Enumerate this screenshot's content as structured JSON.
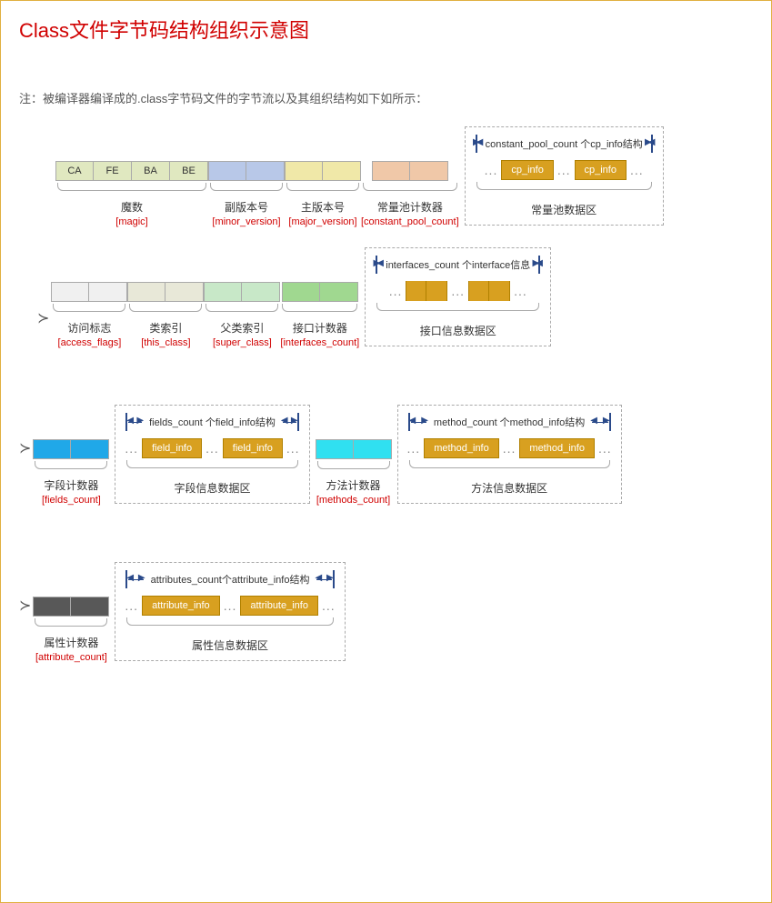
{
  "title": "Class文件字节码结构组织示意图",
  "note": "注：被编译器编译成的.class字节码文件的字节流以及其组织结构如下如所示：",
  "row1": {
    "magic": {
      "bytes": [
        "CA",
        "FE",
        "BA",
        "BE"
      ],
      "cn": "魔数",
      "en": "[magic]"
    },
    "minor": {
      "cn": "副版本号",
      "en": "[minor_version]"
    },
    "major": {
      "cn": "主版本号",
      "en": "[major_version]"
    },
    "cpcount": {
      "cn": "常量池计数器",
      "en": "[constant_pool_count]"
    },
    "cparea": {
      "bar": "constant_pool_count 个cp_info结构",
      "item": "cp_info",
      "label": "常量池数据区"
    }
  },
  "row2": {
    "access": {
      "cn": "访问标志",
      "en": "[access_flags]"
    },
    "this": {
      "cn": "类索引",
      "en": "[this_class]"
    },
    "super": {
      "cn": "父类索引",
      "en": "[super_class]"
    },
    "ifcount": {
      "cn": "接口计数器",
      "en": "[interfaces_count]"
    },
    "ifarea": {
      "bar": "interfaces_count 个interface信息",
      "label": "接口信息数据区"
    }
  },
  "row3": {
    "fcount": {
      "cn": "字段计数器",
      "en": "[fields_count]"
    },
    "farea": {
      "bar": "fields_count 个field_info结构",
      "item": "field_info",
      "label": "字段信息数据区"
    },
    "mcount": {
      "cn": "方法计数器",
      "en": "[methods_count]"
    },
    "marea": {
      "bar": "method_count 个method_info结构",
      "item": "method_info",
      "label": "方法信息数据区"
    }
  },
  "row4": {
    "acount": {
      "cn": "属性计数器",
      "en": "[attribute_count]"
    },
    "aarea": {
      "bar": "attributes_count个attribute_info结构",
      "item": "attribute_info",
      "label": "属性信息数据区"
    }
  },
  "ellipsis": "..."
}
